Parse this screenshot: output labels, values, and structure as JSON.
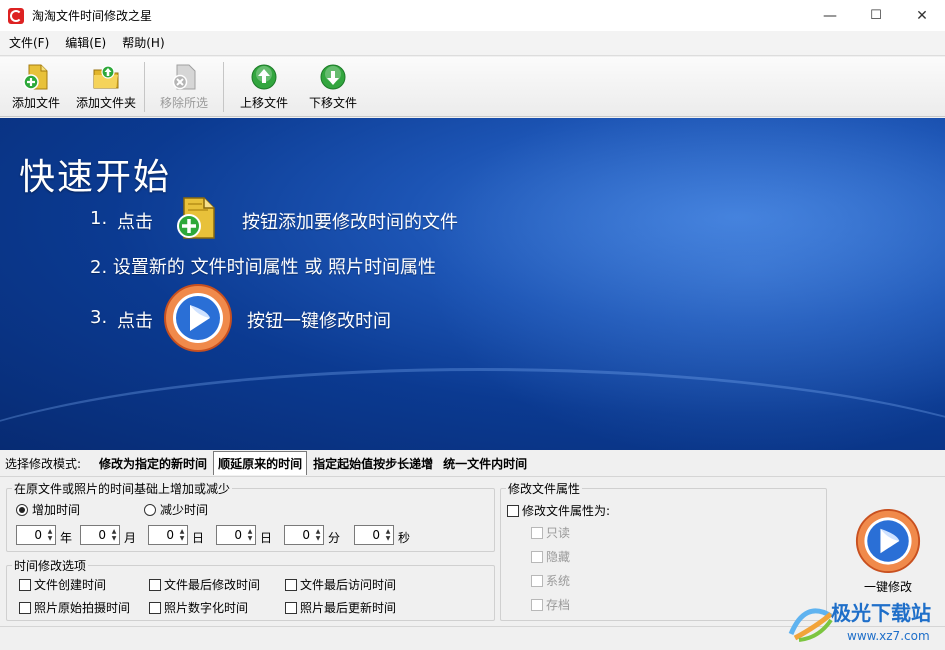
{
  "window": {
    "title": "淘淘文件时间修改之星",
    "minimize": "—",
    "maximize": "☐",
    "close": "✕"
  },
  "menu": [
    "文件(F)",
    "编辑(E)",
    "帮助(H)"
  ],
  "toolbar": {
    "add_file": "添加文件",
    "add_folder": "添加文件夹",
    "remove_selected": "移除所选",
    "move_up": "上移文件",
    "move_down": "下移文件"
  },
  "banner": {
    "title": "快速开始",
    "step1_num": "1.",
    "step1_pre": "点击",
    "step1_post": "按钮添加要修改时间的文件",
    "step2": "2.  设置新的 文件时间属性 或 照片时间属性",
    "step3_num": "3.",
    "step3_pre": "点击",
    "step3_post": "按钮一键修改时间"
  },
  "modes": {
    "label": "选择修改模式:",
    "tabs": [
      "修改为指定的新时间",
      "顺延原来的时间",
      "指定起始值按步长递增",
      "统一文件内时间"
    ],
    "active_index": 1
  },
  "offset_group": {
    "legend": "在原文件或照片的时间基础上增加或减少",
    "increase": "增加时间",
    "decrease": "减少时间",
    "selected": "增加时间",
    "fields": [
      {
        "value": "0",
        "unit": "年"
      },
      {
        "value": "0",
        "unit": "月"
      },
      {
        "value": "0",
        "unit": "日"
      },
      {
        "value": "0",
        "unit": "日"
      },
      {
        "value": "0",
        "unit": "分"
      },
      {
        "value": "0",
        "unit": "秒"
      }
    ]
  },
  "time_options": {
    "legend": "时间修改选项",
    "items": [
      "文件创建时间",
      "文件最后修改时间",
      "文件最后访问时间",
      "照片原始拍摄时间",
      "照片数字化时间",
      "照片最后更新时间"
    ]
  },
  "attr_group": {
    "legend": "修改文件属性",
    "main": "修改文件属性为:",
    "items": [
      "只读",
      "隐藏",
      "系统",
      "存档"
    ]
  },
  "action": {
    "label": "一键修改"
  },
  "watermark": {
    "name": "极光下载站",
    "url": "www.xz7.com"
  }
}
